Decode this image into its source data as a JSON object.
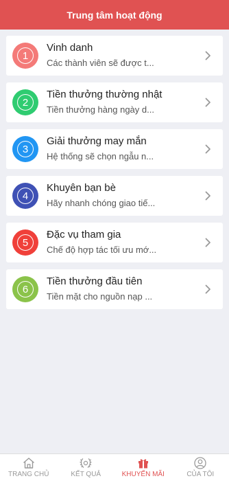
{
  "header": {
    "title": "Trung tâm hoạt động"
  },
  "colors": {
    "header_bg": "#e05252",
    "active_tab": "#e05252",
    "inactive_tab": "#999999"
  },
  "items": [
    {
      "number": "1",
      "title": "Vinh danh",
      "subtitle": "Các thành viên sẽ được t...",
      "badge_color": "#f47a78"
    },
    {
      "number": "2",
      "title": "Tiền thưởng thường nhật",
      "subtitle": "Tiền thưởng hàng ngày d...",
      "badge_color": "#2fcc71"
    },
    {
      "number": "3",
      "title": "Giải thưởng may mắn",
      "subtitle": "Hệ thống sẽ chọn ngẫu n...",
      "badge_color": "#2196f3"
    },
    {
      "number": "4",
      "title": "Khuyên bạn bè",
      "subtitle": "Hãy nhanh chóng giao tiế...",
      "badge_color": "#3f51b5"
    },
    {
      "number": "5",
      "title": "Đặc vụ tham gia",
      "subtitle": "Chế độ hợp tác tối ưu mớ...",
      "badge_color": "#f0403a"
    },
    {
      "number": "6",
      "title": "Tiền thưởng đầu tiên",
      "subtitle": "Tiền mặt cho nguồn nạp ...",
      "badge_color": "#8bc34a"
    }
  ],
  "tabs": [
    {
      "label": "TRANG CHỦ",
      "icon": "home-icon",
      "active": false
    },
    {
      "label": "KẾT QUẢ",
      "icon": "laurel-icon",
      "active": false
    },
    {
      "label": "KHUYẾN MÃI",
      "icon": "gift-icon",
      "active": true
    },
    {
      "label": "CỦA TÔI",
      "icon": "user-icon",
      "active": false
    }
  ]
}
